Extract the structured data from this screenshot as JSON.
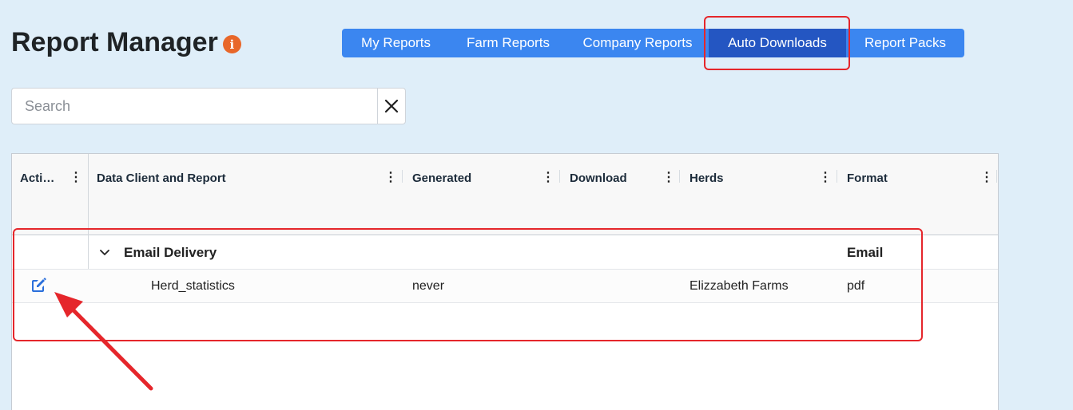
{
  "header": {
    "title": "Report Manager",
    "info_glyph": "i"
  },
  "tabs": [
    {
      "label": "My Reports"
    },
    {
      "label": "Farm Reports"
    },
    {
      "label": "Company Reports"
    },
    {
      "label": "Auto Downloads",
      "active": true
    },
    {
      "label": "Report Packs"
    }
  ],
  "search": {
    "placeholder": "Search",
    "value": ""
  },
  "table": {
    "columns": [
      {
        "label": "Acti…"
      },
      {
        "label": "Data Client and Report"
      },
      {
        "label": "Generated"
      },
      {
        "label": "Download"
      },
      {
        "label": "Herds"
      },
      {
        "label": "Format"
      }
    ],
    "group": {
      "label": "Email Delivery",
      "format": "Email"
    },
    "rows": [
      {
        "report": "Herd_statistics",
        "generated": "never",
        "download": "",
        "herds": "Elizzabeth Farms",
        "format": "pdf"
      }
    ]
  },
  "colors": {
    "tab_bar": "#3b86f0",
    "tab_active": "#2456c2",
    "highlight": "#e5262b",
    "info_badge": "#e8672a",
    "edit_icon": "#2a6fdb"
  },
  "icons": [
    "info-icon",
    "close-icon",
    "kebab-menu-icon",
    "chevron-down-icon",
    "edit-icon",
    "annotation-arrow"
  ]
}
